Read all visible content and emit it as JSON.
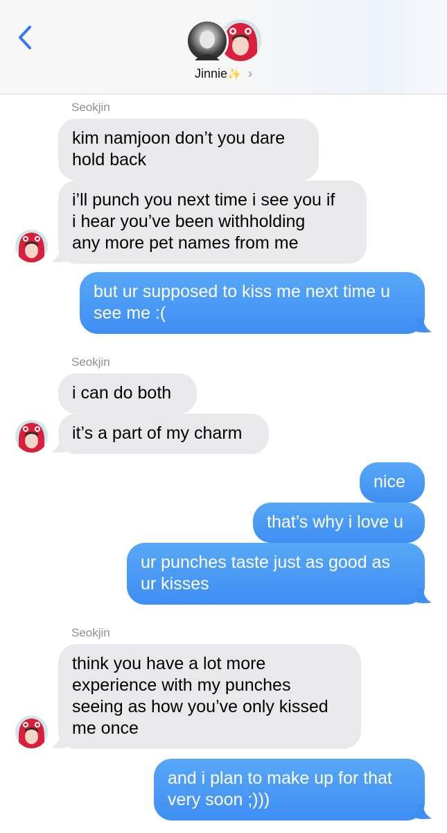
{
  "header": {
    "contact_name": "Jinnie",
    "sparkle": "✨",
    "chevron": "›",
    "back_icon": "chevron-left-icon",
    "accent": "#3478f6"
  },
  "messages": [
    {
      "sender": "Seokjin"
    },
    {
      "line1": "kim namjoon don’t you dare",
      "line2": "hold back"
    },
    {
      "line1": "i’ll punch you next time i see you if",
      "line2": "i hear you’ve been withholding",
      "line3": "any more pet names from me"
    },
    {
      "line1": "but ur supposed to kiss me next time u",
      "line2": "see me :("
    },
    {
      "sender": "Seokjin"
    },
    {
      "line1": "i can do both"
    },
    {
      "line1": "it’s a part of my charm"
    },
    {
      "line1": "nice"
    },
    {
      "line1": "that’s why i love u"
    },
    {
      "line1": "ur punches taste just as good as",
      "line2": "ur kisses"
    },
    {
      "sender": "Seokjin"
    },
    {
      "line1": "think you have a lot more",
      "line2": "experience with my punches",
      "line3": "seeing as how you’ve only kissed",
      "line4": "me once"
    },
    {
      "line1": "and i plan to make up for that",
      "line2": "very soon ;)))"
    }
  ],
  "colors": {
    "incoming_bubble": "#e9e9eb",
    "outgoing_bubble": "#4a9bf5",
    "sender_label": "#8e8e93"
  }
}
